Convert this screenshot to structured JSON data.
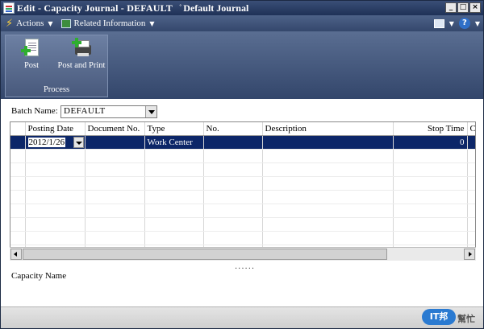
{
  "window": {
    "title": "Edit - Capacity Journal - DEFAULT",
    "subtitle": "Default Journal",
    "buttons": [
      "_",
      "□",
      "×"
    ]
  },
  "cmdbar": {
    "actions": "Actions",
    "related": "Related Information",
    "help": "?"
  },
  "ribbon": {
    "post": "Post",
    "post_and_print": "Post and Print",
    "group": "Process"
  },
  "batch": {
    "label": "Batch Name:",
    "value": "DEFAULT"
  },
  "grid": {
    "columns": [
      "Posting Date",
      "Document No.",
      "Type",
      "No.",
      "Description",
      "Stop Time",
      "Ca"
    ],
    "rows": [
      {
        "posting_date": "2012/1/26",
        "document_no": "",
        "type": "Work Center",
        "no": "",
        "description": "",
        "stop_time": "0",
        "ca": ""
      }
    ]
  },
  "splitter": "......",
  "footer": {
    "capacity_name": "Capacity Name"
  },
  "watermark": {
    "bubble": "IT邦",
    "text": "幫忙"
  },
  "colors": {
    "accent": "#0c2668",
    "titlebar": "#1f3157"
  }
}
